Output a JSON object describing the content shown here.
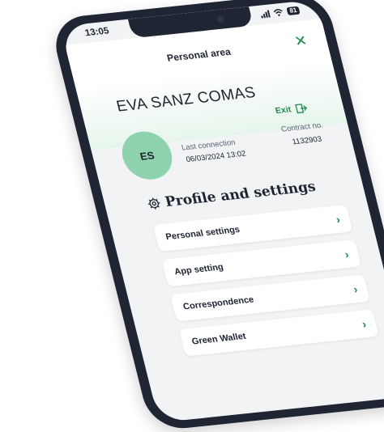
{
  "status_bar": {
    "time": "13:05",
    "battery": "81"
  },
  "header": {
    "title": "Personal area",
    "close_icon": "close-icon",
    "accent_color": "#1f8a4c"
  },
  "user": {
    "name": "EVA SANZ COMAS",
    "initials": "ES",
    "exit_label": "Exit",
    "last_connection_label": "Last connection",
    "last_connection_value": "06/03/2024 13:02",
    "contract_label": "Contract no.",
    "contract_value": "1132903",
    "avatar_color": "#8fd3ae"
  },
  "section": {
    "title": "Profile and settings",
    "icon": "gear-icon"
  },
  "menu": {
    "items": [
      {
        "label": "Personal settings"
      },
      {
        "label": "App setting"
      },
      {
        "label": "Correspondence"
      },
      {
        "label": "Green Wallet"
      }
    ]
  }
}
